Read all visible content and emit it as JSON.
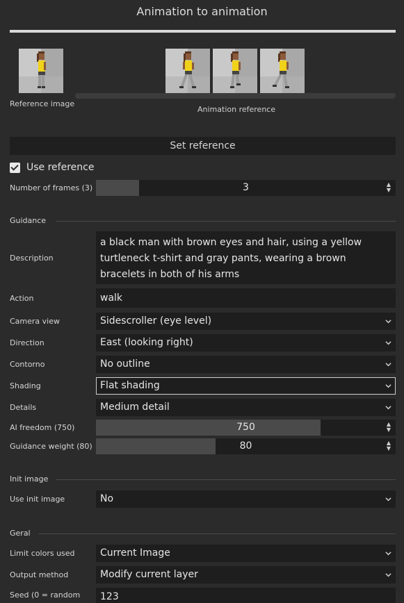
{
  "header": {
    "title": "Animation to animation"
  },
  "reference": {
    "reference_image_label": "Reference image",
    "animation_reference_label": "Animation reference",
    "set_reference_label": "Set reference",
    "use_reference_label": "Use reference",
    "use_reference_checked": true
  },
  "frames": {
    "label": "Number of frames (3)",
    "value": "3",
    "fill_fraction": 0.145
  },
  "guidance": {
    "section_title": "Guidance",
    "description_label": "Description",
    "description_value": "a black man with brown eyes and hair, using a yellow turtleneck t-shirt and gray pants, wearing a brown bracelets in both of his arms",
    "action_label": "Action",
    "action_value": "walk",
    "camera_label": "Camera view",
    "camera_value": "Sidescroller (eye level)",
    "direction_label": "Direction",
    "direction_value": "East (looking right)",
    "outline_label": "Contorno",
    "outline_value": "No outline",
    "shading_label": "Shading",
    "shading_value": "Flat shading",
    "details_label": "Details",
    "details_value": "Medium detail",
    "ai_freedom_label": "AI freedom (750)",
    "ai_freedom_value": "750",
    "ai_freedom_fill": 0.75,
    "guidance_weight_label": "Guidance weight (80)",
    "guidance_weight_value": "80",
    "guidance_weight_fill": 0.4
  },
  "init_image": {
    "section_title": "Init image",
    "use_label": "Use init image",
    "use_value": "No"
  },
  "general": {
    "section_title": "Geral",
    "limit_colors_label": "Limit colors used",
    "limit_colors_value": "Current Image",
    "output_method_label": "Output method",
    "output_method_value": "Modify current layer",
    "seed_label": "Seed (0 = random",
    "seed_value": "123"
  },
  "colors": {
    "background": "#2b2b2b",
    "field": "#1e1e1e",
    "fill": "#4a4a4a",
    "sprite_shirt": "#f0d21a",
    "sprite_skin": "#8a5a3a",
    "sprite_pants": "#9a9a9a"
  },
  "icons": [
    "chevron-down-icon",
    "spin-up-icon",
    "spin-down-icon",
    "checkmark-icon"
  ]
}
